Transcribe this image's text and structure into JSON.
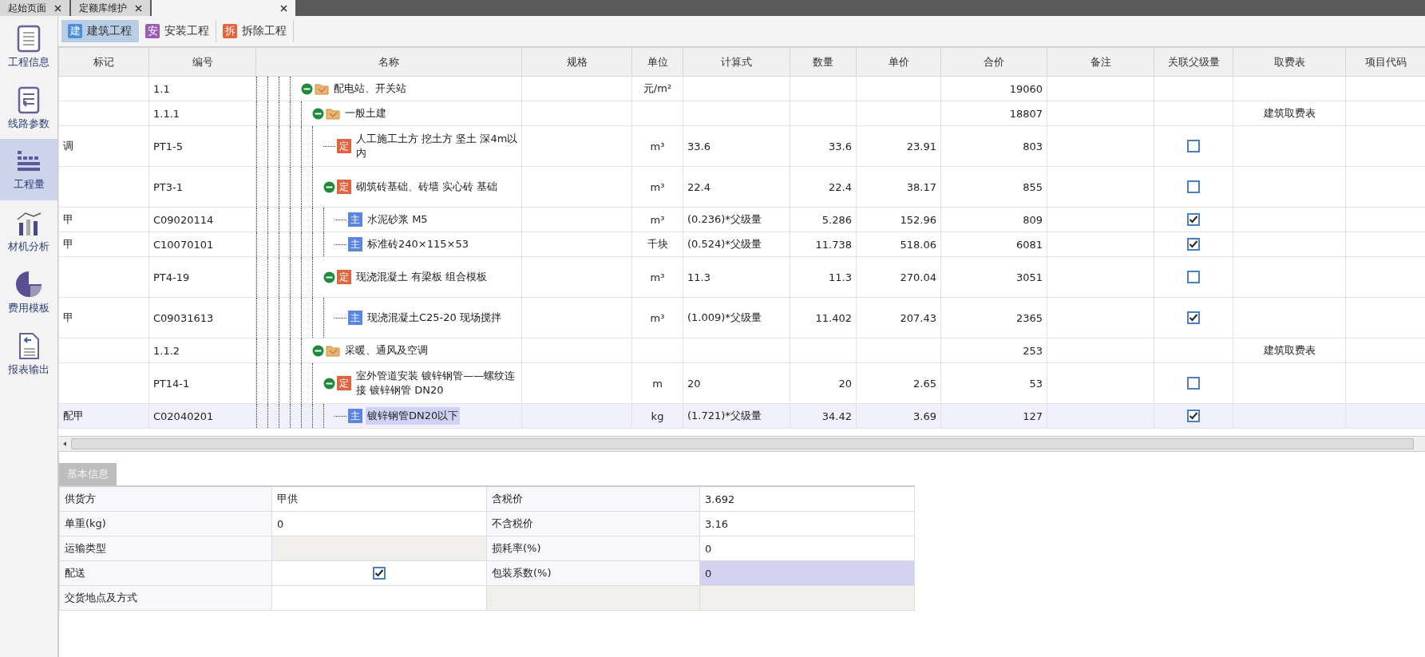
{
  "doc_tabs": [
    {
      "label": "起始页面",
      "selected": false
    },
    {
      "label": "定额库维护",
      "selected": false
    },
    {
      "selected": true
    }
  ],
  "sidebar": {
    "items": [
      {
        "kind": "clipboard",
        "label": "工程信息",
        "selected": false
      },
      {
        "kind": "route",
        "label": "线路参数",
        "selected": false
      },
      {
        "kind": "quantity",
        "label": "工程量",
        "selected": true
      },
      {
        "kind": "analysis",
        "label": "材机分析",
        "selected": false
      },
      {
        "kind": "pie",
        "label": "费用模板",
        "selected": false
      },
      {
        "kind": "report",
        "label": "报表输出",
        "selected": false
      }
    ]
  },
  "toolbar": {
    "tabs": [
      {
        "icon": "建",
        "color": "#4a8ee0",
        "label": "建筑工程",
        "selected": true
      },
      {
        "icon": "安",
        "color": "#9a5cb4",
        "label": "安装工程",
        "selected": false
      },
      {
        "icon": "拆",
        "color": "#e0643c",
        "label": "拆除工程",
        "selected": false
      }
    ]
  },
  "table": {
    "columns": [
      "标记",
      "编号",
      "名称",
      "规格",
      "单位",
      "计算式",
      "数量",
      "单价",
      "合价",
      "备注",
      "关联父级量",
      "取费表",
      "项目代码"
    ],
    "rows": [
      {
        "code": "1.1",
        "kind": "group",
        "expanded": true,
        "name": "配电站、开关站",
        "unit": "元/m²",
        "total": "19060",
        "selected": false,
        "children": [
          {
            "code": "1.1.1",
            "kind": "group",
            "expanded": true,
            "name": "一般土建",
            "total": "18807",
            "fee": "建筑取费表",
            "selected": false,
            "children": [
              {
                "mark": "调",
                "code": "PT1-5",
                "kind": "quota",
                "badge": "定",
                "name": "人工施工土方 挖土方 坚土 深4m以内",
                "unit": "m³",
                "formula": "33.6",
                "qty": "33.6",
                "price": "23.91",
                "total": "803",
                "linked": false,
                "selected": false
              },
              {
                "code": "PT3-1",
                "kind": "quota",
                "badge": "定",
                "expanded": true,
                "name": "砌筑砖基础、砖墙 实心砖 基础",
                "unit": "m³",
                "formula": "22.4",
                "qty": "22.4",
                "price": "38.17",
                "total": "855",
                "linked": false,
                "selected": false,
                "children": [
                  {
                    "mark": "甲",
                    "code": "C09020114",
                    "kind": "material",
                    "badge": "主",
                    "name": "水泥砂浆 M5",
                    "unit": "m³",
                    "formula": "(0.236)*父级量",
                    "qty": "5.286",
                    "price": "152.96",
                    "total": "809",
                    "linked": true,
                    "selected": false
                  },
                  {
                    "mark": "甲",
                    "code": "C10070101",
                    "kind": "material",
                    "badge": "主",
                    "name": "标准砖240×115×53",
                    "unit": "千块",
                    "formula": "(0.524)*父级量",
                    "qty": "11.738",
                    "price": "518.06",
                    "total": "6081",
                    "linked": true,
                    "selected": false
                  }
                ]
              },
              {
                "code": "PT4-19",
                "kind": "quota",
                "badge": "定",
                "expanded": true,
                "name": "现浇混凝土 有梁板 组合模板",
                "unit": "m³",
                "formula": "11.3",
                "qty": "11.3",
                "price": "270.04",
                "total": "3051",
                "linked": false,
                "selected": false,
                "children": [
                  {
                    "mark": "甲",
                    "code": "C09031613",
                    "kind": "material",
                    "badge": "主",
                    "name": "现浇混凝土C25-20 现场搅拌",
                    "unit": "m³",
                    "formula": "(1.009)*父级量",
                    "qty": "11.402",
                    "price": "207.43",
                    "total": "2365",
                    "linked": true,
                    "selected": false
                  }
                ]
              }
            ]
          },
          {
            "code": "1.1.2",
            "kind": "group",
            "expanded": true,
            "name": "采暖、通风及空调",
            "total": "253",
            "fee": "建筑取费表",
            "selected": false,
            "children": [
              {
                "code": "PT14-1",
                "kind": "quota",
                "badge": "定",
                "expanded": true,
                "name": "室外管道安装 镀锌钢管——螺纹连接 镀锌钢管 DN20",
                "unit": "m",
                "formula": "20",
                "qty": "20",
                "price": "2.65",
                "total": "53",
                "linked": false,
                "selected": false,
                "children": [
                  {
                    "mark": "配甲",
                    "code": "C02040201",
                    "kind": "material",
                    "badge": "主",
                    "name": "镀锌钢管DN20以下",
                    "unit": "kg",
                    "formula": "(1.721)*父级量",
                    "qty": "34.42",
                    "price": "3.69",
                    "total": "127",
                    "linked": true,
                    "selected": true
                  }
                ]
              }
            ]
          }
        ]
      }
    ]
  },
  "detail": {
    "tab": "基本信息",
    "fields": [
      {
        "kind": "text",
        "label": "供货方",
        "value": "甲供",
        "selected": false
      },
      {
        "kind": "text",
        "label": "含税价",
        "value": "3.692",
        "selected": false
      },
      {
        "kind": "text",
        "label": "单重(kg)",
        "value": "0",
        "selected": false
      },
      {
        "kind": "text",
        "label": "不含税价",
        "value": "3.16",
        "selected": false
      },
      {
        "kind": "readonly",
        "label": "运输类型",
        "selected": false
      },
      {
        "kind": "text",
        "label": "损耗率(%)",
        "value": "0",
        "selected": false
      },
      {
        "kind": "checkbox",
        "label": "配送",
        "checked": true,
        "selected": false
      },
      {
        "kind": "text",
        "label": "包装系数(%)",
        "value": "0",
        "selected": true
      },
      {
        "kind": "text",
        "label": "交货地点及方式",
        "selected": false
      },
      {
        "kind": "blank",
        "selected": false
      }
    ]
  }
}
